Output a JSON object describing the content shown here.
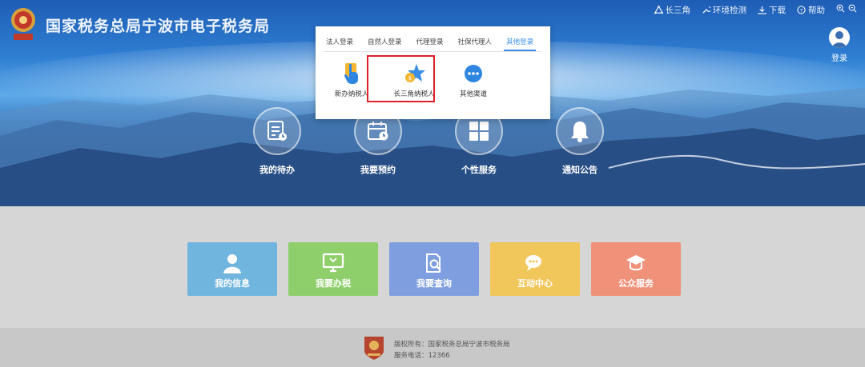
{
  "header": {
    "site_title": "国家税务总局宁波市电子税务局",
    "nav": [
      {
        "label": "长三角",
        "icon": "network-icon"
      },
      {
        "label": "环境检测",
        "icon": "wrench-icon"
      },
      {
        "label": "下载",
        "icon": "download-icon"
      },
      {
        "label": "帮助",
        "icon": "help-icon"
      }
    ],
    "zoom_icons": [
      "zoom-in-icon",
      "zoom-out-icon"
    ],
    "login_label": "登录"
  },
  "features": [
    {
      "label": "我的待办",
      "icon": "todo-icon"
    },
    {
      "label": "我要预约",
      "icon": "calendar-icon"
    },
    {
      "label": "个性服务",
      "icon": "grid-icon"
    },
    {
      "label": "通知公告",
      "icon": "bell-icon"
    }
  ],
  "cards": [
    {
      "label": "我的信息",
      "icon": "user-icon",
      "color": "#6fb5de"
    },
    {
      "label": "我要办税",
      "icon": "monitor-icon",
      "color": "#8fcf6b"
    },
    {
      "label": "我要查询",
      "icon": "search-doc-icon",
      "color": "#7f9ee0"
    },
    {
      "label": "互动中心",
      "icon": "chat-icon",
      "color": "#f1c65a"
    },
    {
      "label": "公众服务",
      "icon": "graduation-icon",
      "color": "#f0917a"
    }
  ],
  "footer": {
    "copyright": "版权所有：国家税务总局宁波市税务局",
    "phone": "服务电话：12366"
  },
  "login_popup": {
    "tabs": [
      "法人登录",
      "自然人登录",
      "代理登录",
      "社保代理人",
      "其他登录"
    ],
    "active_tab": "其他登录",
    "options": [
      {
        "label": "新办纳税人",
        "icon": "hand-pointer-icon"
      },
      {
        "label": "长三角纳税人",
        "icon": "star-badge-icon"
      },
      {
        "label": "其他渠道",
        "icon": "more-dots-icon"
      }
    ],
    "highlighted_option": "长三角纳税人"
  },
  "colors": {
    "accent_blue": "#3a8ee6",
    "highlight_red": "#e0202a"
  }
}
